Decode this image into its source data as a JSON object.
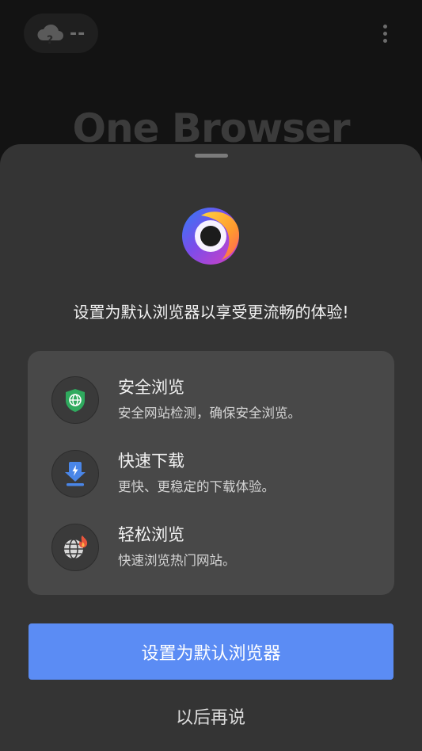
{
  "background": {
    "weather": {
      "icon": "cloud-question-icon",
      "value": "--"
    },
    "menu_icon": "more-vertical-icon",
    "brand_title": "One Browser"
  },
  "sheet": {
    "logo_icon": "one-browser-logo",
    "headline": "设置为默认浏览器以享受更流畅的体验!",
    "features": [
      {
        "icon": "shield-globe-icon",
        "title": "安全浏览",
        "description": "安全网站检测，确保安全浏览。"
      },
      {
        "icon": "download-flash-icon",
        "title": "快速下载",
        "description": "更快、更稳定的下载体验。"
      },
      {
        "icon": "globe-fire-icon",
        "title": "轻松浏览",
        "description": "快速浏览热门网站。"
      }
    ],
    "primary_button": "设置为默认浏览器",
    "secondary_button": "以后再说"
  },
  "colors": {
    "accent": "#5b8cf4",
    "sheet_background": "#343434",
    "card_background": "#484848",
    "shield_green": "#2faa5e",
    "download_blue": "#4a86e8",
    "fire_red": "#e8553c"
  }
}
